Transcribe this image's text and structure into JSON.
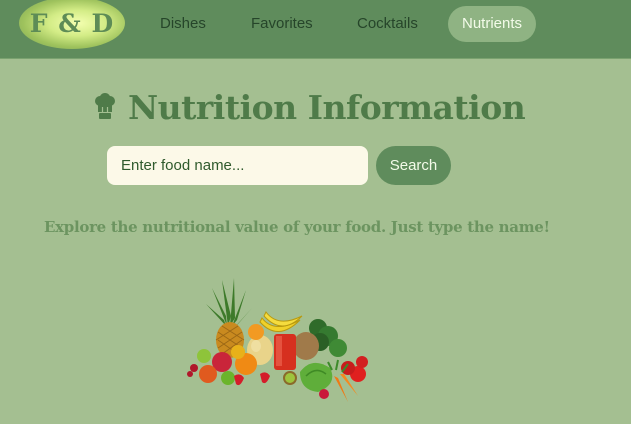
{
  "nav": {
    "logo_text": "F & D",
    "items": [
      {
        "label": "Dishes",
        "active": false
      },
      {
        "label": "Favorites",
        "active": false
      },
      {
        "label": "Cocktails",
        "active": false
      },
      {
        "label": "Nutrients",
        "active": true
      }
    ]
  },
  "main": {
    "title": "Nutrition Information",
    "title_icon": "chef-hat-icon",
    "search": {
      "placeholder": "Enter food name...",
      "value": "",
      "button_label": "Search"
    },
    "tagline": "Explore the nutritional value of your food. Just type the name!",
    "image": "fruits-and-vegetables-illustration"
  },
  "colors": {
    "page_bg": "#a4bf91",
    "navbar_bg": "#5f8c5c",
    "active_tab_bg": "#8fb383",
    "title": "#4f7b49",
    "tagline": "#6c9460",
    "input_bg": "#fcf9e8"
  }
}
